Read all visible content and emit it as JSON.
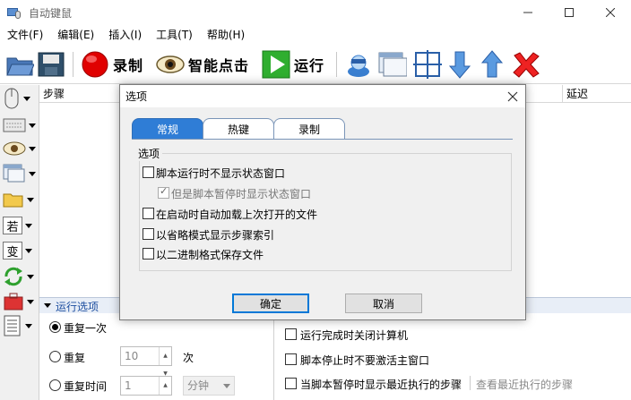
{
  "window": {
    "title": "自动键鼠"
  },
  "menu": [
    {
      "label": "文件(F)"
    },
    {
      "label": "编辑(E)"
    },
    {
      "label": "插入(I)"
    },
    {
      "label": "工具(T)"
    },
    {
      "label": "帮助(H)"
    }
  ],
  "toolbar": {
    "record_label": "录制",
    "smart_click_label": "智能点击",
    "run_label": "运行"
  },
  "left_tools": {
    "char1": "若",
    "char2": "变"
  },
  "table": {
    "col_steps": "步骤",
    "col_delay": "延迟"
  },
  "run_options": {
    "header": "运行选项",
    "repeat_once": "重复一次",
    "repeat": "重复",
    "repeat_count": "10",
    "times_unit": "次",
    "repeat_time": "重复时间",
    "repeat_time_value": "1",
    "time_unit": "分钟",
    "shutdown_after": "运行完成时关闭计算机",
    "no_activate_on_stop": "脚本停止时不要激活主窗口",
    "show_last_step_on_pause": "当脚本暂停时显示最近执行的步骤",
    "view_last_step": "查看最近执行的步骤"
  },
  "dialog": {
    "title": "选项",
    "tabs": [
      "常规",
      "热键",
      "录制"
    ],
    "group_title": "选项",
    "options": [
      {
        "label": "脚本运行时不显示状态窗口",
        "checked": false,
        "disabled": false
      },
      {
        "label": "但是脚本暂停时显示状态窗口",
        "checked": true,
        "disabled": true
      },
      {
        "label": "在启动时自动加载上次打开的文件",
        "checked": false,
        "disabled": false
      },
      {
        "label": "以省略模式显示步骤索引",
        "checked": false,
        "disabled": false
      },
      {
        "label": "以二进制格式保存文件",
        "checked": false,
        "disabled": false
      }
    ],
    "ok": "确定",
    "cancel": "取消"
  },
  "colors": {
    "accent_tab": "#2f7dd6",
    "run_header_text": "#1e4fa0"
  }
}
